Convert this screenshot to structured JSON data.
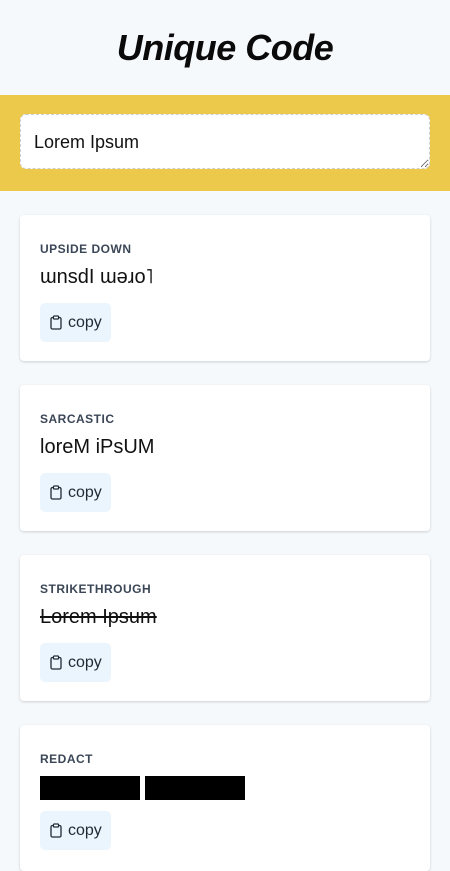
{
  "app": {
    "title": "Unique Code"
  },
  "input": {
    "value": "Lorem Ipsum"
  },
  "cards": [
    {
      "label": "UPSIDE DOWN",
      "output": "ɯnsdI ɯǝɹo˥",
      "copy_label": "copy"
    },
    {
      "label": "SARCASTIC",
      "output": "loreM iPsUM",
      "copy_label": "copy"
    },
    {
      "label": "STRIKETHROUGH",
      "output": "Lorem Ipsum",
      "copy_label": "copy"
    },
    {
      "label": "REDACT",
      "output": "█████ █████",
      "copy_label": "copy"
    }
  ],
  "icons": {
    "copy": "clipboard-icon"
  },
  "colors": {
    "page_background": "#f5f9fc",
    "input_band": "#ecc94b",
    "copy_button_bg": "#ebf5fd",
    "label_text": "#3b4656"
  }
}
